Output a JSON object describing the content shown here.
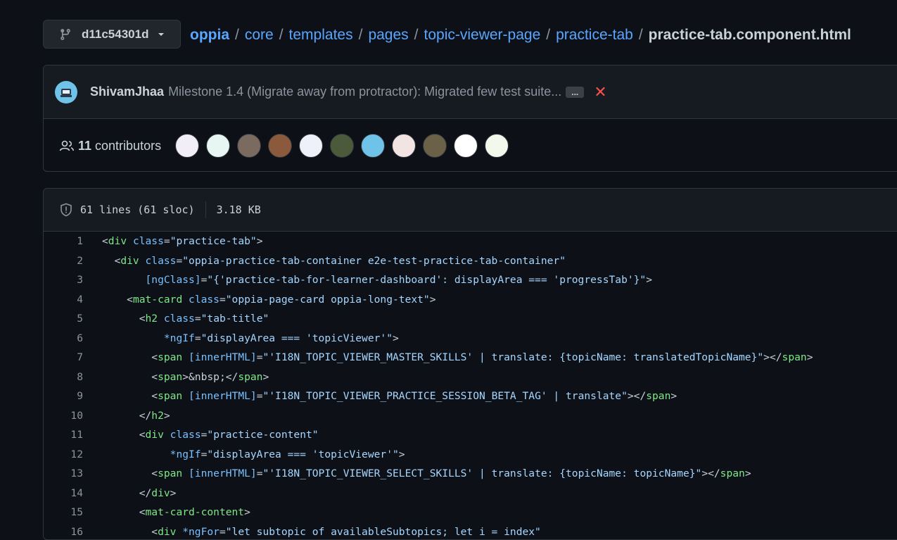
{
  "branch": {
    "name": "d11c54301d",
    "icon": "git-branch-icon"
  },
  "breadcrumb": {
    "root": "oppia",
    "parts": [
      "core",
      "templates",
      "pages",
      "topic-viewer-page",
      "practice-tab"
    ],
    "separator": "/",
    "file": "practice-tab.component.html"
  },
  "commit": {
    "author": "ShivamJhaa",
    "message": "Milestone 1.4 (Migrate away from protractor): Migrated few test suite...",
    "ellipsis": "...",
    "status": "✕"
  },
  "contributors": {
    "count": "11",
    "label": "contributors",
    "avatar_colors": [
      "#f1eef8",
      "#e8f6f3",
      "#7b6a5f",
      "#8b5a3c",
      "#eef0fa",
      "#4a5a3a",
      "#6fc3e8",
      "#f3e4e4",
      "#6b6048",
      "#ffffff",
      "#f2f8ec"
    ]
  },
  "file_info": {
    "lines": "61 lines (61 sloc)",
    "size": "3.18 KB"
  },
  "code": [
    {
      "n": "1",
      "tokens": [
        [
          "p",
          "<"
        ],
        [
          "t",
          "div"
        ],
        [
          "p",
          " "
        ],
        [
          "a",
          "class"
        ],
        [
          "p",
          "="
        ],
        [
          "s",
          "\"practice-tab\""
        ],
        [
          "p",
          ">"
        ]
      ]
    },
    {
      "n": "2",
      "tokens": [
        [
          "p",
          "  <"
        ],
        [
          "t",
          "div"
        ],
        [
          "p",
          " "
        ],
        [
          "a",
          "class"
        ],
        [
          "p",
          "="
        ],
        [
          "s",
          "\"oppia-practice-tab-container e2e-test-practice-tab-container\""
        ]
      ]
    },
    {
      "n": "3",
      "tokens": [
        [
          "p",
          "       "
        ],
        [
          "a",
          "[ngClass]"
        ],
        [
          "p",
          "="
        ],
        [
          "s",
          "\"{'practice-tab-for-learner-dashboard': displayArea === 'progressTab'}\""
        ],
        [
          "p",
          ">"
        ]
      ]
    },
    {
      "n": "4",
      "tokens": [
        [
          "p",
          "    <"
        ],
        [
          "t",
          "mat-card"
        ],
        [
          "p",
          " "
        ],
        [
          "a",
          "class"
        ],
        [
          "p",
          "="
        ],
        [
          "s",
          "\"oppia-page-card oppia-long-text\""
        ],
        [
          "p",
          ">"
        ]
      ]
    },
    {
      "n": "5",
      "tokens": [
        [
          "p",
          "      <"
        ],
        [
          "t",
          "h2"
        ],
        [
          "p",
          " "
        ],
        [
          "a",
          "class"
        ],
        [
          "p",
          "="
        ],
        [
          "s",
          "\"tab-title\""
        ]
      ]
    },
    {
      "n": "6",
      "tokens": [
        [
          "p",
          "          "
        ],
        [
          "a",
          "*ngIf"
        ],
        [
          "p",
          "="
        ],
        [
          "s",
          "\"displayArea === 'topicViewer'\""
        ],
        [
          "p",
          ">"
        ]
      ]
    },
    {
      "n": "7",
      "tokens": [
        [
          "p",
          "        <"
        ],
        [
          "t",
          "span"
        ],
        [
          "p",
          " "
        ],
        [
          "a",
          "[innerHTML]"
        ],
        [
          "p",
          "="
        ],
        [
          "s",
          "\"'I18N_TOPIC_VIEWER_MASTER_SKILLS' | translate: {topicName: translatedTopicName}\""
        ],
        [
          "p",
          "></"
        ],
        [
          "t",
          "span"
        ],
        [
          "p",
          ">"
        ]
      ]
    },
    {
      "n": "8",
      "tokens": [
        [
          "p",
          "        <"
        ],
        [
          "t",
          "span"
        ],
        [
          "p",
          ">&nbsp;</"
        ],
        [
          "t",
          "span"
        ],
        [
          "p",
          ">"
        ]
      ]
    },
    {
      "n": "9",
      "tokens": [
        [
          "p",
          "        <"
        ],
        [
          "t",
          "span"
        ],
        [
          "p",
          " "
        ],
        [
          "a",
          "[innerHTML]"
        ],
        [
          "p",
          "="
        ],
        [
          "s",
          "\"'I18N_TOPIC_VIEWER_PRACTICE_SESSION_BETA_TAG' | translate\""
        ],
        [
          "p",
          "></"
        ],
        [
          "t",
          "span"
        ],
        [
          "p",
          ">"
        ]
      ]
    },
    {
      "n": "10",
      "tokens": [
        [
          "p",
          "      </"
        ],
        [
          "t",
          "h2"
        ],
        [
          "p",
          ">"
        ]
      ]
    },
    {
      "n": "11",
      "tokens": [
        [
          "p",
          "      <"
        ],
        [
          "t",
          "div"
        ],
        [
          "p",
          " "
        ],
        [
          "a",
          "class"
        ],
        [
          "p",
          "="
        ],
        [
          "s",
          "\"practice-content\""
        ]
      ]
    },
    {
      "n": "12",
      "tokens": [
        [
          "p",
          "           "
        ],
        [
          "a",
          "*ngIf"
        ],
        [
          "p",
          "="
        ],
        [
          "s",
          "\"displayArea === 'topicViewer'\""
        ],
        [
          "p",
          ">"
        ]
      ]
    },
    {
      "n": "13",
      "tokens": [
        [
          "p",
          "        <"
        ],
        [
          "t",
          "span"
        ],
        [
          "p",
          " "
        ],
        [
          "a",
          "[innerHTML]"
        ],
        [
          "p",
          "="
        ],
        [
          "s",
          "\"'I18N_TOPIC_VIEWER_SELECT_SKILLS' | translate: {topicName: topicName}\""
        ],
        [
          "p",
          "></"
        ],
        [
          "t",
          "span"
        ],
        [
          "p",
          ">"
        ]
      ]
    },
    {
      "n": "14",
      "tokens": [
        [
          "p",
          "      </"
        ],
        [
          "t",
          "div"
        ],
        [
          "p",
          ">"
        ]
      ]
    },
    {
      "n": "15",
      "tokens": [
        [
          "p",
          "      <"
        ],
        [
          "t",
          "mat-card-content"
        ],
        [
          "p",
          ">"
        ]
      ]
    },
    {
      "n": "16",
      "tokens": [
        [
          "p",
          "        <"
        ],
        [
          "t",
          "div"
        ],
        [
          "p",
          " "
        ],
        [
          "a",
          "*ngFor"
        ],
        [
          "p",
          "="
        ],
        [
          "s",
          "\"let subtopic of availableSubtopics; let i = index\""
        ]
      ]
    }
  ]
}
